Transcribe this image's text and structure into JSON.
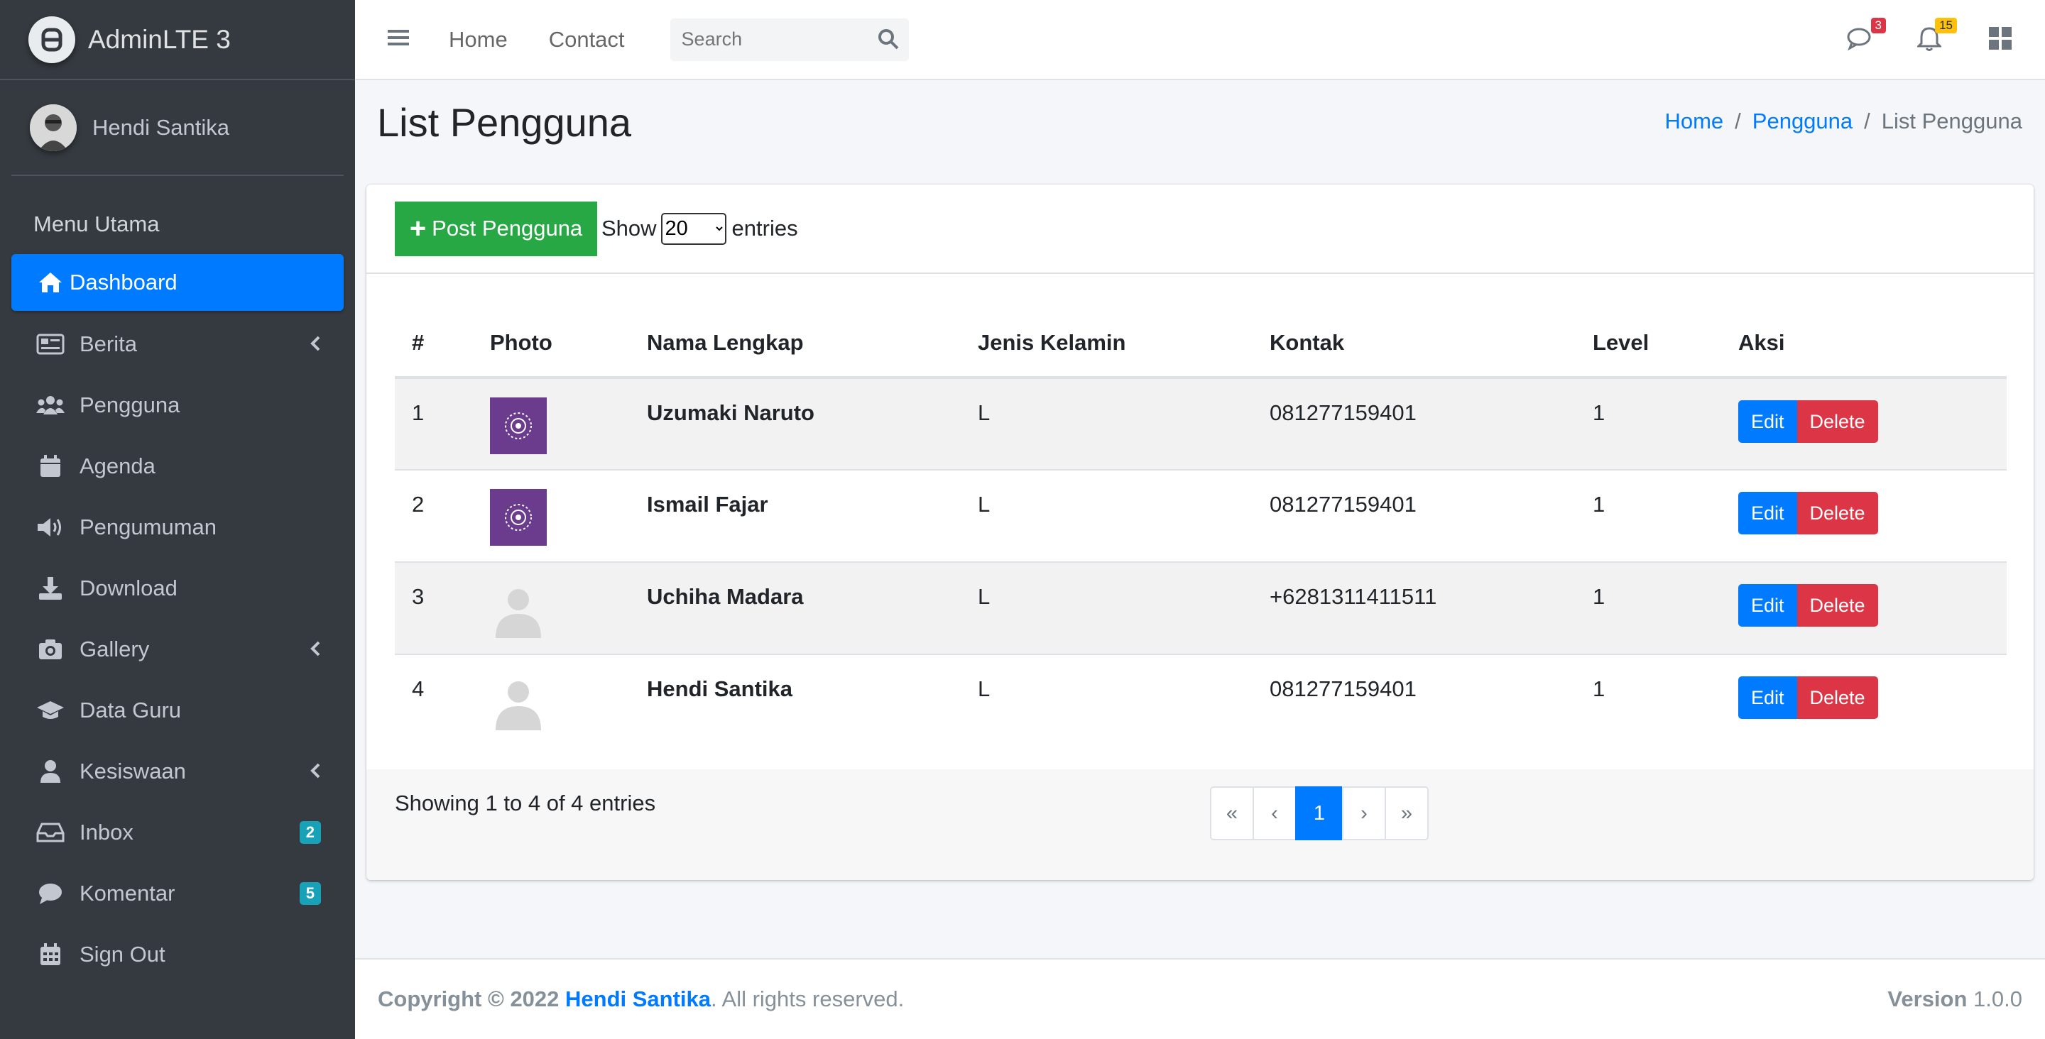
{
  "brand": {
    "name": "AdminLTE 3"
  },
  "user": {
    "name": "Hendi Santika"
  },
  "sidebar": {
    "header": "Menu Utama",
    "items": [
      {
        "label": "Dashboard",
        "icon": "home-icon"
      },
      {
        "label": "Berita",
        "icon": "newspaper-icon",
        "has_submenu": true
      },
      {
        "label": "Pengguna",
        "icon": "users-icon"
      },
      {
        "label": "Agenda",
        "icon": "calendar-icon"
      },
      {
        "label": "Pengumuman",
        "icon": "megaphone-icon"
      },
      {
        "label": "Download",
        "icon": "download-icon"
      },
      {
        "label": "Gallery",
        "icon": "camera-icon",
        "has_submenu": true
      },
      {
        "label": "Data Guru",
        "icon": "graduation-cap-icon"
      },
      {
        "label": "Kesiswaan",
        "icon": "user-icon",
        "has_submenu": true
      },
      {
        "label": "Inbox",
        "icon": "inbox-icon",
        "badge": "2"
      },
      {
        "label": "Komentar",
        "icon": "comment-icon",
        "badge": "5"
      },
      {
        "label": "Sign Out",
        "icon": "calendar-grid-icon"
      }
    ]
  },
  "topnav": {
    "home": "Home",
    "contact": "Contact",
    "search_placeholder": "Search",
    "messages_badge": "3",
    "notifications_badge": "15"
  },
  "page": {
    "title": "List Pengguna",
    "breadcrumb": {
      "home": "Home",
      "section": "Pengguna",
      "current": "List Pengguna"
    }
  },
  "toolbar": {
    "post_label": "Post Pengguna",
    "show_label": "Show",
    "entries_value": "20",
    "entries_label": "entries"
  },
  "table": {
    "headers": [
      "#",
      "Photo",
      "Nama Lengkap",
      "Jenis Kelamin",
      "Kontak",
      "Level",
      "Aksi"
    ],
    "rows": [
      {
        "no": "1",
        "photo": "mandala",
        "name": "Uzumaki Naruto",
        "gender": "L",
        "contact": "081277159401",
        "level": "1"
      },
      {
        "no": "2",
        "photo": "mandala",
        "name": "Ismail Fajar",
        "gender": "L",
        "contact": "081277159401",
        "level": "1"
      },
      {
        "no": "3",
        "photo": "placeholder",
        "name": "Uchiha Madara",
        "gender": "L",
        "contact": "+6281311411511",
        "level": "1"
      },
      {
        "no": "4",
        "photo": "placeholder",
        "name": "Hendi Santika",
        "gender": "L",
        "contact": "081277159401",
        "level": "1"
      }
    ],
    "edit_label": "Edit",
    "delete_label": "Delete"
  },
  "pagination": {
    "showing": "Showing 1 to 4 of 4 entries",
    "first": "«",
    "prev": "‹",
    "current": "1",
    "next": "›",
    "last": "»"
  },
  "footer": {
    "copyright": "Copyright © 2022",
    "author": "Hendi Santika",
    "rights": ". All rights reserved.",
    "version_label": "Version",
    "version": "1.0.0"
  },
  "colors": {
    "primary": "#007bff",
    "success": "#28a745",
    "danger": "#dc3545",
    "warning": "#ffc107",
    "info": "#17a2b8",
    "sidebar": "#343a40"
  }
}
